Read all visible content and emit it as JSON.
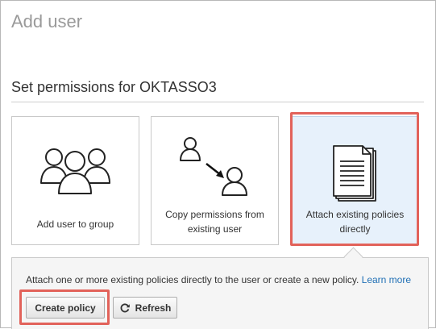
{
  "page": {
    "title": "Add user",
    "section_title": "Set permissions for OKTASSO3"
  },
  "options": [
    {
      "label": "Add user to group",
      "icon": "user-group-icon",
      "selected": false
    },
    {
      "label": "Copy permissions from existing user",
      "icon": "copy-user-icon",
      "selected": false
    },
    {
      "label": "Attach existing policies directly",
      "icon": "policy-document-icon",
      "selected": true
    }
  ],
  "panel": {
    "description": "Attach one or more existing policies directly to the user or create a new policy.",
    "learn_more": "Learn more"
  },
  "buttons": {
    "create_policy": "Create policy",
    "refresh": "Refresh"
  },
  "colors": {
    "highlight": "#e2625a",
    "selected_bg": "#e7f1fb",
    "link": "#1f6fb5"
  }
}
